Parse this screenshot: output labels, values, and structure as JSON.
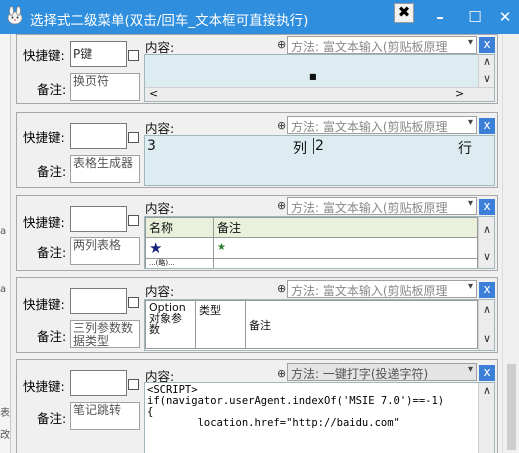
{
  "window": {
    "title": "选择式二级菜单(双击/回车_文本框可直接执行)",
    "pin_label": "✖",
    "minimize": "–",
    "maximize": "☐",
    "close": "✕"
  },
  "labels": {
    "hotkey": "快捷键:",
    "note": "备注:",
    "content": "内容:",
    "move_glyph": "⊕",
    "delete": "x",
    "dropdown": "▾"
  },
  "left_strip": [
    "a",
    "a",
    "表",
    "改"
  ],
  "items": [
    {
      "hotkey": "P键",
      "note": "换页符",
      "method": "方法: 富文本输入(剪贴板原理",
      "body": "■"
    },
    {
      "hotkey": "",
      "note": "表格生成器",
      "method": "方法: 富文本输入(剪贴板原理",
      "cells": [
        "3",
        "列",
        "2",
        "行"
      ]
    },
    {
      "hotkey": "",
      "note": "两列表格",
      "method": "方法: 富文本输入(剪贴板原理",
      "table_header": [
        "名称",
        "备注"
      ],
      "table_row": [
        "★",
        "★"
      ],
      "table_cut": "...(略)..."
    },
    {
      "hotkey": "",
      "note": "三列参数数据类型",
      "method": "方法: 富文本输入(剪贴板原理",
      "table_header": [
        "Option对象参数",
        "类型",
        "备注"
      ]
    },
    {
      "hotkey": "",
      "note": "笔记跳转",
      "method": "方法: 一键打字(投递字符)",
      "code": "<SCRIPT>\nif(navigator.userAgent.indexOf('MSIE 7.0')==-1)\n{\n        location.href=\"http://baidu.com\""
    }
  ]
}
